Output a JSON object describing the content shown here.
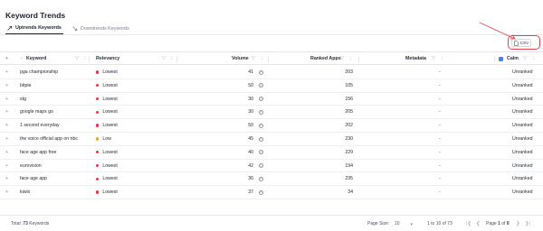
{
  "page": {
    "title": "Keyword Trends"
  },
  "tabs": [
    {
      "label": "Uptrends Keywords",
      "active": true,
      "icon": "trending-up-icon"
    },
    {
      "label": "Downtrends Keywords",
      "active": false,
      "icon": "trending-down-icon"
    }
  ],
  "toolbar": {
    "csv_label": "CSV"
  },
  "columns": {
    "keyword": "Keyword",
    "relevancy": "Relevancy",
    "volume": "Volume",
    "ranked_apps": "Ranked Apps",
    "metadata": "Metadata",
    "calm": "Calm"
  },
  "colors": {
    "lowest": "#e03a3e",
    "low": "#f0a23a",
    "accent": "#3b82f6",
    "highlight": "#e3464a"
  },
  "rows": [
    {
      "keyword": "pga championship",
      "relevancy": "Lowest",
      "level": "lowest",
      "volume": "41",
      "ranked_apps": "203",
      "metadata": "-",
      "calm": "Unranked"
    },
    {
      "keyword": "bitpie",
      "relevancy": "Lowest",
      "level": "lowest",
      "volume": "50",
      "ranked_apps": "105",
      "metadata": "-",
      "calm": "Unranked"
    },
    {
      "keyword": "stg",
      "relevancy": "Lowest",
      "level": "lowest",
      "volume": "30",
      "ranked_apps": "156",
      "metadata": "-",
      "calm": "Unranked"
    },
    {
      "keyword": "google maps go",
      "relevancy": "Lowest",
      "level": "lowest",
      "volume": "30",
      "ranked_apps": "205",
      "metadata": "-",
      "calm": "Unranked"
    },
    {
      "keyword": "1 second everyday",
      "relevancy": "Lowest",
      "level": "lowest",
      "volume": "50",
      "ranked_apps": "202",
      "metadata": "-",
      "calm": "Unranked"
    },
    {
      "keyword": "the voice official app on nbc",
      "relevancy": "Low",
      "level": "low",
      "volume": "45",
      "ranked_apps": "230",
      "metadata": "-",
      "calm": "Unranked"
    },
    {
      "keyword": "face age app free",
      "relevancy": "Lowest",
      "level": "lowest",
      "volume": "40",
      "ranked_apps": "229",
      "metadata": "-",
      "calm": "Unranked"
    },
    {
      "keyword": "eurovision",
      "relevancy": "Lowest",
      "level": "lowest",
      "volume": "42",
      "ranked_apps": "194",
      "metadata": "-",
      "calm": "Unranked"
    },
    {
      "keyword": "face age app",
      "relevancy": "Lowest",
      "level": "lowest",
      "volume": "36",
      "ranked_apps": "235",
      "metadata": "-",
      "calm": "Unranked"
    },
    {
      "keyword": "kiwix",
      "relevancy": "Lowest",
      "level": "lowest",
      "volume": "37",
      "ranked_apps": "34",
      "metadata": "-",
      "calm": "Unranked"
    }
  ],
  "footer": {
    "total_prefix": "Total:",
    "total_count": "73",
    "total_suffix": "Keywords",
    "page_size_label": "Page Size:",
    "page_size_value": "10",
    "range": "1 to 10 of 73",
    "page_prefix": "Page",
    "page_current": "1",
    "page_of": "of",
    "page_total": "8"
  }
}
